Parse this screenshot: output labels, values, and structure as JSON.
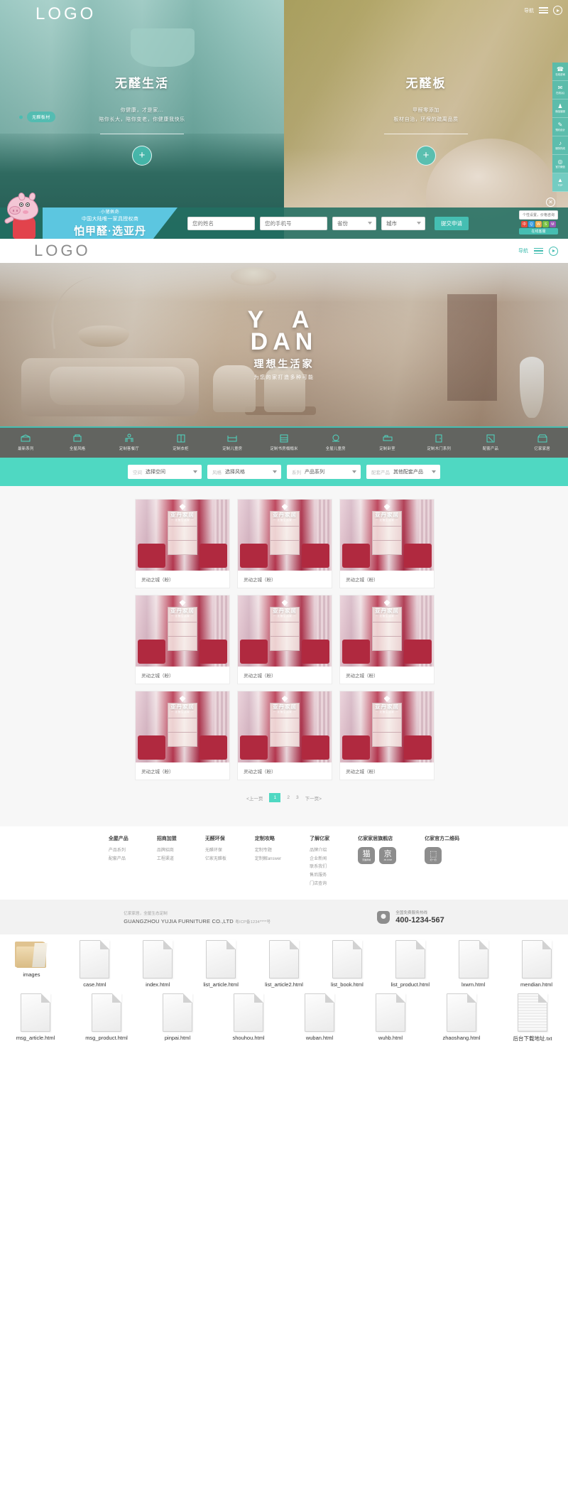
{
  "hero_top": {
    "logo": "LOGO",
    "nav_label": "导航",
    "left": {
      "tag": "无醛板材",
      "title": "无醛生活",
      "sub_line1": "你健康，才是家...",
      "sub_line2": "陪你长大，陪你变老，你健康我快乐",
      "plus": "+"
    },
    "right": {
      "title": "无醛板",
      "sub_line1": "甲醛零添加",
      "sub_line2": "板材自治，环保的疏离品质",
      "plus": "+"
    },
    "vertical_tools": [
      {
        "glyph": "☎",
        "label": "在线咨询"
      },
      {
        "glyph": "✉",
        "label": "在线QQ"
      },
      {
        "glyph": "♟",
        "label": "微信客服"
      },
      {
        "glyph": "✎",
        "label": "预约设计"
      },
      {
        "glyph": "♪",
        "label": "服务热线"
      },
      {
        "glyph": "◎",
        "label": "官方微信"
      },
      {
        "glyph": "▲",
        "label": "TOP"
      }
    ]
  },
  "form_bar": {
    "mascot_alt": "peppa-pig-mascot",
    "banner_line1": "·小猪佩奇·",
    "banner_line2": "中国大陆唯一家具授权商",
    "banner_line3": "怕甲醛·选亚丹",
    "name_placeholder": "您的姓名",
    "phone_placeholder": "您的手机号",
    "province_value": "省份",
    "city_value": "城市",
    "submit_label": "提交申请",
    "chat_tip": "个性设置，价格咨询",
    "chat_bar": "在线客服",
    "close": "✕"
  },
  "header": {
    "logo": "LOGO",
    "nav_label": "导航"
  },
  "hero_main": {
    "ya": "Y A",
    "dan": "DAN",
    "cn_title": "理想生活家",
    "slogan": "为您的家打造多种可能"
  },
  "icon_nav": [
    {
      "icon": "sofa-icon",
      "label": "最新系列"
    },
    {
      "icon": "armchair-icon",
      "label": "全屋风格"
    },
    {
      "icon": "people-icon",
      "label": "定制客餐厅"
    },
    {
      "icon": "wardrobe-icon",
      "label": "定制衣柜"
    },
    {
      "icon": "kidsbed-icon",
      "label": "定制儿童房"
    },
    {
      "icon": "bookcase-icon",
      "label": "定制书房榻榻米"
    },
    {
      "icon": "kitchen-icon",
      "label": "全屋儿童房"
    },
    {
      "icon": "bed-icon",
      "label": "定制卧室"
    },
    {
      "icon": "door-icon",
      "label": "定制木门系列"
    },
    {
      "icon": "board-icon",
      "label": "配套产品"
    },
    {
      "icon": "store-icon",
      "label": "亿家家居"
    }
  ],
  "filters": [
    {
      "key": "空间",
      "value": "选择空间"
    },
    {
      "key": "风格",
      "value": "选择风格"
    },
    {
      "key": "系列",
      "value": "产品系列"
    },
    {
      "key": "配套产品",
      "value": "其他配套产品"
    }
  ],
  "product_watermark": {
    "brand": "亚丹家居",
    "sub": "一 无醛生活家 一"
  },
  "products": [
    {
      "title": "灵动之城（粉）"
    },
    {
      "title": "灵动之城（粉）"
    },
    {
      "title": "灵动之城（粉）"
    },
    {
      "title": "灵动之城（粉）"
    },
    {
      "title": "灵动之城（粉）"
    },
    {
      "title": "灵动之城（粉）"
    },
    {
      "title": "灵动之城（粉）"
    },
    {
      "title": "灵动之城（粉）"
    },
    {
      "title": "灵动之城（粉）"
    }
  ],
  "pagination": {
    "prev": "<上一页",
    "pages": [
      "1",
      "2",
      "3"
    ],
    "current": "1",
    "next": "下一页>"
  },
  "footer": {
    "columns": [
      {
        "title": "全屋产品",
        "links": [
          "产品系列",
          "配套产品"
        ]
      },
      {
        "title": "招商加盟",
        "links": [
          "品牌招商",
          "工程渠道"
        ]
      },
      {
        "title": "无醛环保",
        "links": [
          "无醛环保",
          "亿家无醛板"
        ]
      },
      {
        "title": "定制攻略",
        "links": [
          "定制专题",
          "定制解answer"
        ]
      },
      {
        "title": "了解亿家",
        "links": [
          "品牌介绍",
          "企业新闻",
          "联系我们",
          "售后服务",
          "门店查询"
        ]
      }
    ],
    "qr_title_1": "亿家家居旗舰店",
    "qr_title_2": "亿家官方二维码",
    "qr_items_1": [
      {
        "glyph": "猫",
        "cap": "天猫商城"
      },
      {
        "glyph": "京",
        "cap": "JD.COM"
      }
    ],
    "qr_items_2": [
      {
        "glyph": "⬚",
        "cap": "扫一扫"
      }
    ]
  },
  "copyright": {
    "line1": "亿家家居，全屋生态定制",
    "line2_main": "GUANGZHOU YUJIA FURNITURE CO.,LTD",
    "line2_icp": "粤ICP备1234****号",
    "hotline_label": "全国免费服务热线",
    "hotline_number": "400-1234-567"
  },
  "files": {
    "row1": [
      {
        "name": "images",
        "type": "folder"
      },
      {
        "name": "case.html",
        "type": "doc"
      },
      {
        "name": "index.html",
        "type": "doc"
      },
      {
        "name": "list_article.html",
        "type": "doc"
      },
      {
        "name": "list_article2.html",
        "type": "doc"
      },
      {
        "name": "list_book.html",
        "type": "doc"
      },
      {
        "name": "list_product.html",
        "type": "doc"
      },
      {
        "name": "lxwm.html",
        "type": "doc"
      },
      {
        "name": "mendian.html",
        "type": "doc"
      }
    ],
    "row2": [
      {
        "name": "msg_article.html",
        "type": "doc"
      },
      {
        "name": "msg_product.html",
        "type": "doc"
      },
      {
        "name": "pinpai.html",
        "type": "doc"
      },
      {
        "name": "shouhou.html",
        "type": "doc"
      },
      {
        "name": "wuban.html",
        "type": "doc"
      },
      {
        "name": "wuhb.html",
        "type": "doc"
      },
      {
        "name": "zhaoshang.html",
        "type": "doc"
      },
      {
        "name": "后台下载地址.txt",
        "type": "txt"
      }
    ]
  },
  "colors": {
    "teal": "#45beb2",
    "mint": "#4fd8c2",
    "blue_banner": "#5cc6e0",
    "red": "#e2434c"
  }
}
